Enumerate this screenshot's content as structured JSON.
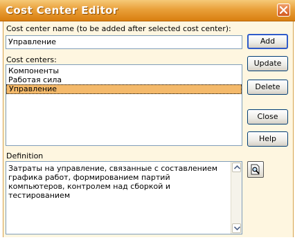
{
  "window": {
    "title": "Cost Center Editor"
  },
  "form": {
    "name_label": "Cost center name (to be added after selected cost center):",
    "name_value": "Управление",
    "list_label": "Cost centers:",
    "items": [
      {
        "label": "Компоненты",
        "selected": false
      },
      {
        "label": "Работая сила",
        "selected": false
      },
      {
        "label": "Управление",
        "selected": true
      }
    ],
    "definition_label": "Definition",
    "definition_text": "Затраты на управление, связанные с составлением графика работ, формированием партий компьютеров, контролем над сборкой и тестированием"
  },
  "buttons": {
    "add": "Add",
    "update": "Update",
    "delete": "Delete",
    "close": "Close",
    "help": "Help"
  },
  "icons": {
    "close": "close-x-icon",
    "preview": "magnifier-document-icon",
    "scroll_up": "scroll-up-arrow-icon",
    "scroll_down": "scroll-down-arrow-icon"
  },
  "colors": {
    "titlebar": "#e9a03a",
    "client_bg": "#fef6e0",
    "selection": "#f4b96a",
    "default_button_border": "#2e5ac9"
  }
}
